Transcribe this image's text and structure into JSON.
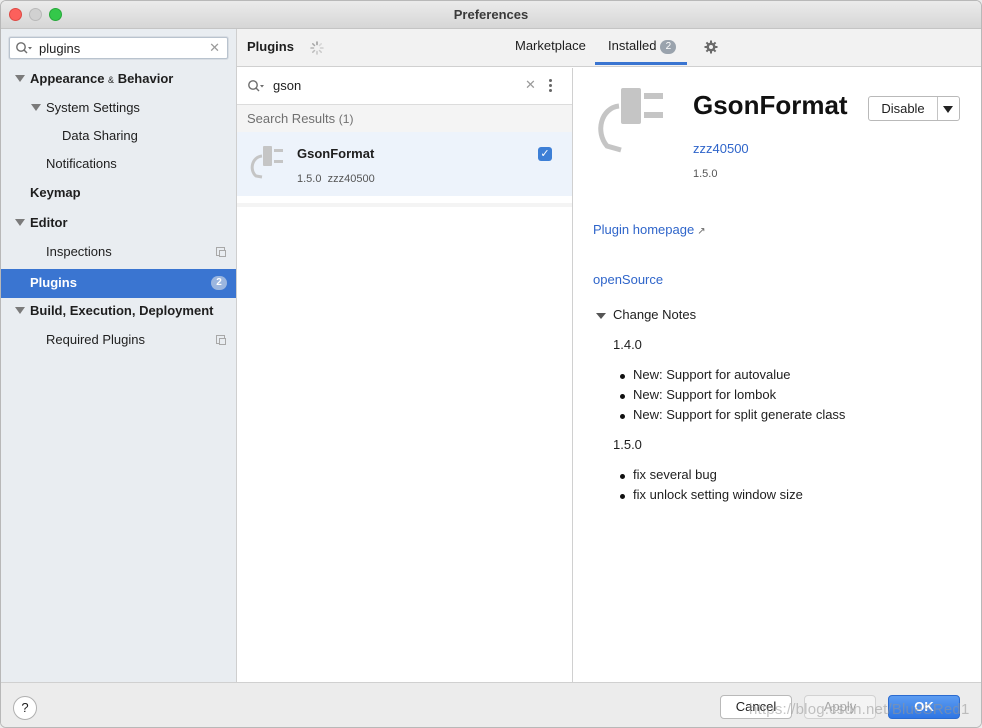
{
  "window": {
    "title": "Preferences"
  },
  "sidebar": {
    "search_value": "plugins",
    "items": [
      {
        "label": "Appearance",
        "label_suffix": "Behavior",
        "amp": "&"
      },
      {
        "label": "System Settings"
      },
      {
        "label": "Data Sharing"
      },
      {
        "label": "Notifications"
      },
      {
        "label": "Keymap"
      },
      {
        "label": "Editor"
      },
      {
        "label": "Inspections"
      },
      {
        "label": "Plugins",
        "badge": "2"
      },
      {
        "label": "Build, Execution, Deployment"
      },
      {
        "label": "Required Plugins"
      }
    ]
  },
  "header": {
    "title": "Plugins",
    "tabs": [
      {
        "label": "Marketplace"
      },
      {
        "label": "Installed",
        "badge": "2"
      }
    ]
  },
  "plugin_list": {
    "search_value": "gson",
    "results_label": "Search Results",
    "results_count": "(1)",
    "plugins": [
      {
        "name": "GsonFormat",
        "version": "1.5.0",
        "vendor": "zzz40500",
        "enabled": true
      }
    ]
  },
  "detail": {
    "name": "GsonFormat",
    "vendor": "zzz40500",
    "version": "1.5.0",
    "disable_label": "Disable",
    "homepage_link": "Plugin homepage",
    "homepage_arrow": "↗",
    "opensource_link": "openSource",
    "change_notes_title": "Change Notes",
    "changes": [
      {
        "version": "1.4.0",
        "notes": [
          "New: Support for autovalue",
          "New: Support for lombok",
          "New: Support for split generate class"
        ]
      },
      {
        "version": "1.5.0",
        "notes": [
          "fix several bug",
          "fix unlock setting window size"
        ]
      }
    ]
  },
  "footer": {
    "help_label": "?",
    "cancel_label": "Cancel",
    "apply_label": "Apply",
    "ok_label": "OK"
  },
  "watermark": "https://blog.csdn.net/BlueSRed1"
}
